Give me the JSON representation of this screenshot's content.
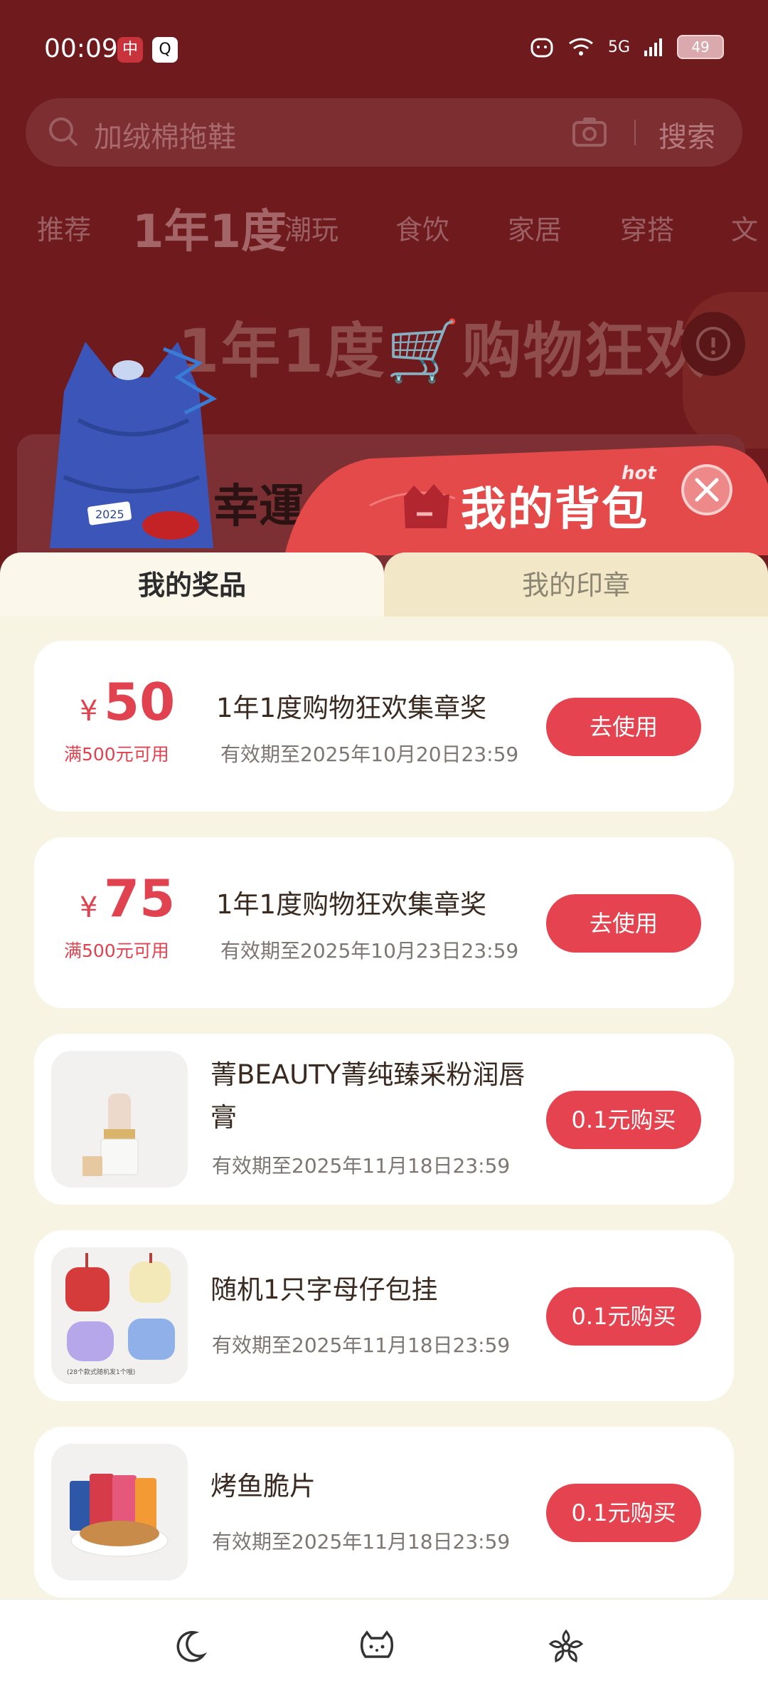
{
  "status_bar": {
    "time": "00:09",
    "app1_glyph": "中",
    "app2_glyph": "Q",
    "network": "5G",
    "battery": "49"
  },
  "search": {
    "placeholder": "加绒棉拖鞋",
    "button_label": "搜索"
  },
  "nav_tabs": [
    "推荐",
    "1年1度",
    "潮玩",
    "食饮",
    "家居",
    "穿搭",
    "文"
  ],
  "banner": {
    "title": "1年1度🛒购物狂欢",
    "card_text": "幸運"
  },
  "sheet": {
    "title": "我的背包",
    "hot_tag": "hot",
    "tabs": {
      "prizes": "我的奖品",
      "stamps": "我的印章"
    }
  },
  "coupons": [
    {
      "symbol": "¥",
      "amount": "50",
      "condition": "满500元可用",
      "title": "1年1度购物狂欢集章奖",
      "expire": "有效期至2025年10月20日23:59",
      "button": "去使用"
    },
    {
      "symbol": "¥",
      "amount": "75",
      "condition": "满500元可用",
      "title": "1年1度购物狂欢集章奖",
      "expire": "有效期至2025年10月23日23:59",
      "button": "去使用"
    }
  ],
  "products": [
    {
      "title": "菁BEAUTY菁纯臻采粉润唇膏",
      "expire": "有效期至2025年11月18日23:59",
      "button": "0.1元购买",
      "image": "lipstick-image"
    },
    {
      "title": "随机1只字母仔包挂",
      "expire": "有效期至2025年11月18日23:59",
      "button": "0.1元购买",
      "image": "letter-keychain-image",
      "image_caption": "(28个款式随机发1个哦)"
    },
    {
      "title": "烤鱼脆片",
      "expire": "有效期至2025年11月18日23:59",
      "button": "0.1元购买",
      "image": "fish-chips-image"
    }
  ],
  "bottom_nav": [
    "moon-icon",
    "hello-kitty-icon",
    "flower-icon"
  ],
  "colors": {
    "accent": "#e5434f",
    "backdrop": "#6f1a1d",
    "sheet_bg": "#f8f4e4"
  }
}
